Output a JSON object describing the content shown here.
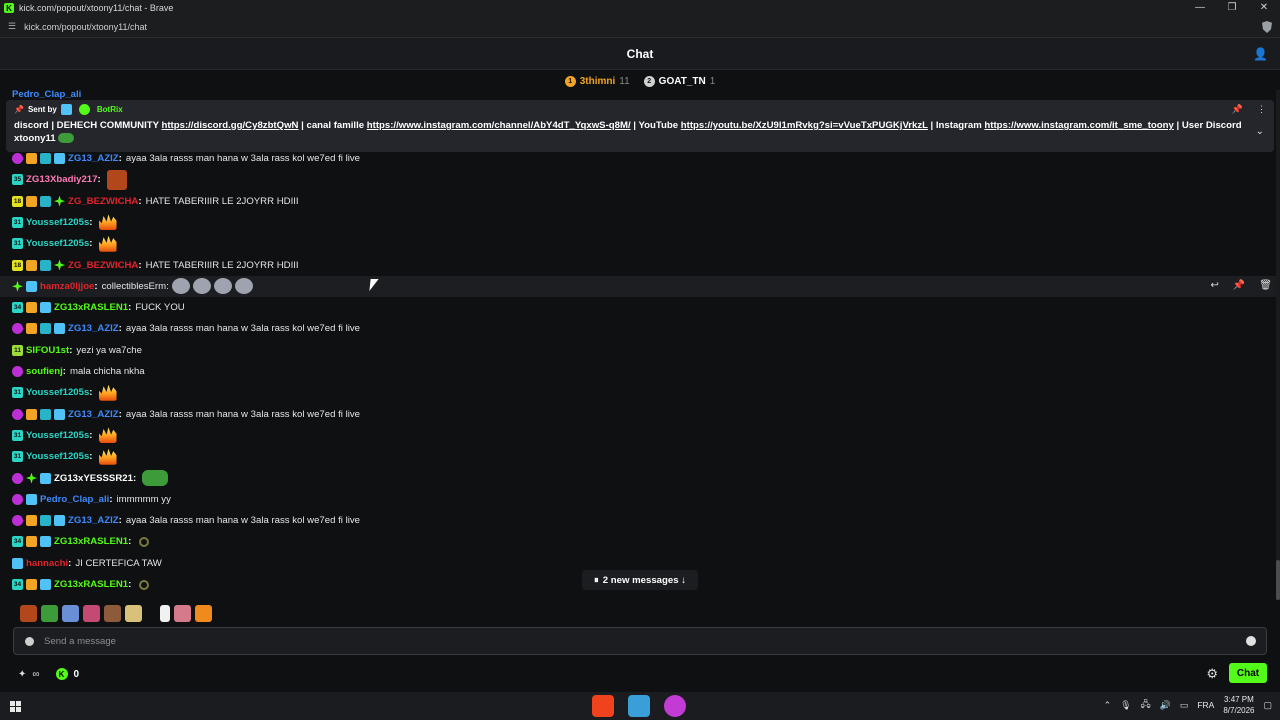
{
  "browser": {
    "title": "kick.com/popout/xtoony11/chat - Brave",
    "url": "kick.com/popout/xtoony11/chat",
    "controls": [
      "—",
      "❐",
      "✕"
    ]
  },
  "header": {
    "title": "Chat"
  },
  "leaderboard": [
    {
      "rank": "1",
      "name": "3thimni",
      "count": "11",
      "color": "#f2a524",
      "badge_color": "#f2a524"
    },
    {
      "rank": "2",
      "name": "GOAT_TN",
      "count": "1",
      "color": "#ffffff",
      "badge_color": "#d0d0d0"
    }
  ],
  "partial_top": {
    "name": "Pedro_Clap_ali"
  },
  "pinned": {
    "sent_by_label": "Sent by",
    "bot_name": "BotRix",
    "segments": [
      {
        "t": "discord | DEHECH COMMUNITY ",
        "link": false
      },
      {
        "t": "https://discord.gg/Cy8zbtQwN",
        "link": true
      },
      {
        "t": " | canal famille ",
        "link": false
      },
      {
        "t": "https://www.instagram.com/channel/AbY4dT_YqxwS-q8M/",
        "link": true
      },
      {
        "t": " | YouTube ",
        "link": false
      },
      {
        "t": "https://youtu.be/XzU9l1mRvkg?si=vVueTxPUGKjVrkzL",
        "link": true
      },
      {
        "t": " | Instagram ",
        "link": false
      },
      {
        "t": "https://www.instagram.com/it_sme_toony",
        "link": true
      },
      {
        "t": " | User Discord xtoony11",
        "link": false
      }
    ]
  },
  "messages": [
    {
      "badges": [
        "sub",
        "crown",
        "grid",
        "verif"
      ],
      "name": "ZG13_AZIZ",
      "color": "#3d8bff",
      "text": "ayaa 3ala rasss man hana w 3ala rass kol we7ed fi live",
      "emotes": []
    },
    {
      "badges": [
        "month:35"
      ],
      "name": "ZG13Xbadiy217",
      "color": "#ff7ab8",
      "text": "",
      "emotes": [
        "img"
      ]
    },
    {
      "badges": [
        "month-y:18",
        "crown",
        "grid",
        "star"
      ],
      "name": "ZG_BEZWICHA",
      "color": "#e0242b",
      "text": "HATE TABERIIIR LE 2JOYRR HDIII",
      "emotes": []
    },
    {
      "badges": [
        "month:31"
      ],
      "name": "Youssef1205s",
      "color": "#29d6c6",
      "text": "",
      "emotes": [
        "fire"
      ]
    },
    {
      "badges": [
        "month:31"
      ],
      "name": "Youssef1205s",
      "color": "#29d6c6",
      "text": "",
      "emotes": [
        "fire"
      ]
    },
    {
      "badges": [
        "month-y:18",
        "crown",
        "grid",
        "star"
      ],
      "name": "ZG_BEZWICHA",
      "color": "#e0242b",
      "text": "HATE TABERIIIR LE 2JOYRR HDIII",
      "emotes": []
    },
    {
      "badges": [
        "star",
        "verif"
      ],
      "name": "hamza0ljjoe",
      "color": "#e0242b",
      "text": "collectiblesErm:",
      "emotes": [
        "cat",
        "cat",
        "cat",
        "cat"
      ],
      "hover": true
    },
    {
      "badges": [
        "month:34",
        "crown",
        "verif"
      ],
      "name": "ZG13xRASLEN1",
      "color": "#53fc18",
      "text": "FUCK YOU",
      "emotes": []
    },
    {
      "badges": [
        "sub",
        "crown",
        "grid",
        "verif"
      ],
      "name": "ZG13_AZIZ",
      "color": "#3d8bff",
      "text": "ayaa 3ala rasss man hana w 3ala rass kol we7ed fi live",
      "emotes": []
    },
    {
      "badges": [
        "month-g:11"
      ],
      "name": "SIFOU1st",
      "color": "#53fc18",
      "text": "yezi ya wa7che",
      "emotes": []
    },
    {
      "badges": [
        "sub"
      ],
      "name": "soufienj",
      "color": "#53fc18",
      "text": "mala chicha nkha",
      "emotes": []
    },
    {
      "badges": [
        "month:31"
      ],
      "name": "Youssef1205s",
      "color": "#29d6c6",
      "text": "",
      "emotes": [
        "fire"
      ]
    },
    {
      "badges": [
        "sub",
        "crown",
        "grid",
        "verif"
      ],
      "name": "ZG13_AZIZ",
      "color": "#3d8bff",
      "text": "ayaa 3ala rasss man hana w 3ala rass kol we7ed fi live",
      "emotes": []
    },
    {
      "badges": [
        "month:31"
      ],
      "name": "Youssef1205s",
      "color": "#29d6c6",
      "text": "",
      "emotes": [
        "fire"
      ]
    },
    {
      "badges": [
        "month:31"
      ],
      "name": "Youssef1205s",
      "color": "#29d6c6",
      "text": "",
      "emotes": [
        "fire"
      ]
    },
    {
      "badges": [
        "sub",
        "star",
        "verif"
      ],
      "name": "ZG13xYESSSR21",
      "color": "#ffffff",
      "text": "",
      "emotes": [
        "frog"
      ]
    },
    {
      "badges": [
        "sub",
        "verif"
      ],
      "name": "Pedro_Clap_ali",
      "color": "#3d8bff",
      "text": "immmmm yy",
      "emotes": []
    },
    {
      "badges": [
        "sub",
        "crown",
        "grid",
        "verif"
      ],
      "name": "ZG13_AZIZ",
      "color": "#3d8bff",
      "text": "ayaa 3ala rasss man hana w 3ala rass kol we7ed fi live",
      "emotes": []
    },
    {
      "badges": [
        "month:34",
        "crown",
        "verif"
      ],
      "name": "ZG13xRASLEN1",
      "color": "#53fc18",
      "text": "",
      "emotes": [
        "spin"
      ]
    },
    {
      "badges": [
        "verif"
      ],
      "name": "hannachi",
      "color": "#e0242b",
      "text": "JI CERTEFICA TAW",
      "emotes": []
    },
    {
      "badges": [
        "month:34",
        "crown",
        "verif"
      ],
      "name": "ZG13xRASLEN1",
      "color": "#53fc18",
      "text": "",
      "emotes": [
        "spin"
      ]
    }
  ],
  "new_messages_label": "2 new messages ↓",
  "new_messages_icon": "⏸",
  "emote_bar_colors": [
    "#b3471c",
    "#3d9b3a",
    "#6a8fd6",
    "#c24a73",
    "#8d5a3c",
    "#d8c27a",
    "#f1f1f1",
    "#d47a8a",
    "#f08a1c"
  ],
  "input": {
    "placeholder": "Send a message"
  },
  "bottom": {
    "kicks_count": "0",
    "send_label": "Chat",
    "infinity": "∞"
  },
  "taskbar": {
    "time": "3:47 PM",
    "date": "8/7/2026",
    "language": "FRA",
    "app_colors": [
      "#f0421c",
      "#3a9fd8",
      "#c23bd4"
    ]
  },
  "colors": {
    "accent": "#53fc18",
    "background": "#0f1011"
  }
}
